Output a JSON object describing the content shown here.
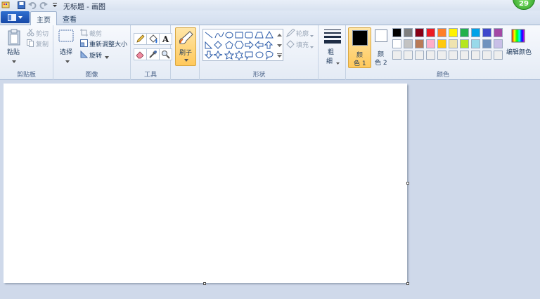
{
  "window": {
    "title": "无标题 - 画图",
    "badge": "29"
  },
  "tabs": [
    {
      "label": "主页",
      "active": true
    },
    {
      "label": "查看",
      "active": false
    }
  ],
  "clipboard": {
    "paste": "粘贴",
    "cut": "剪切",
    "copy": "复制",
    "group": "剪贴板"
  },
  "image": {
    "select": "选择",
    "crop": "裁剪",
    "resize": "重新调整大小",
    "rotate": "旋转",
    "group": "图像"
  },
  "tools": {
    "group": "工具"
  },
  "brushes": {
    "label": "刷子"
  },
  "shapes": {
    "outline": "轮廓",
    "fill": "填充",
    "group": "形状"
  },
  "size": {
    "label_top": "粗",
    "label_bottom": "细"
  },
  "colors": {
    "color1_top": "颜",
    "color1_bottom": "色 1",
    "color2_top": "颜",
    "color2_bottom": "色 2",
    "edit": "编辑颜色",
    "group": "颜色",
    "color1_value": "#000000",
    "color2_value": "#ffffff",
    "palette": [
      "#000000",
      "#7f7f7f",
      "#880015",
      "#ed1c24",
      "#ff7f27",
      "#fff200",
      "#22b14c",
      "#00a2e8",
      "#3f48cc",
      "#a349a4",
      "#ffffff",
      "#c3c3c3",
      "#b97a57",
      "#ffaec9",
      "#ffc90e",
      "#efe4b0",
      "#b5e61d",
      "#99d9ea",
      "#7092be",
      "#c8bfe7",
      "#eeeeee",
      "#eeeeee",
      "#eeeeee",
      "#eeeeee",
      "#eeeeee",
      "#eeeeee",
      "#eeeeee",
      "#eeeeee",
      "#eeeeee",
      "#eeeeee"
    ]
  }
}
